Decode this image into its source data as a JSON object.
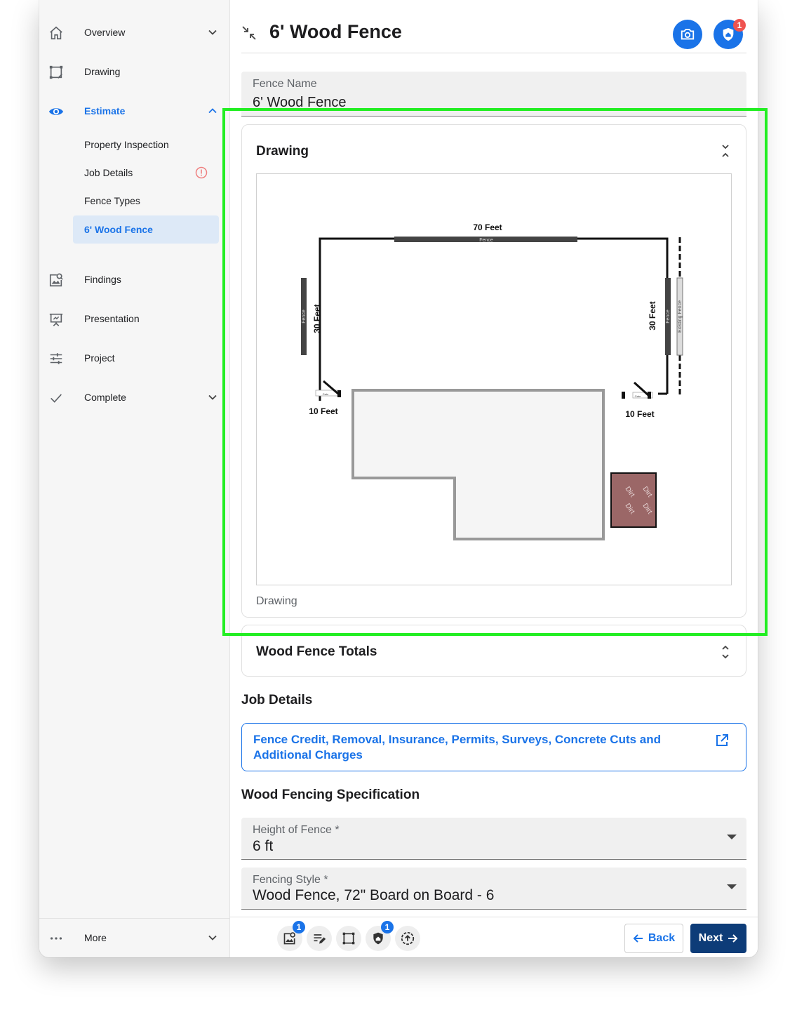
{
  "sidebar": {
    "items": [
      {
        "label": "Overview"
      },
      {
        "label": "Drawing"
      },
      {
        "label": "Estimate"
      },
      {
        "label": "Findings"
      },
      {
        "label": "Presentation"
      },
      {
        "label": "Project"
      },
      {
        "label": "Complete"
      }
    ],
    "estimate_children": [
      {
        "label": "Property Inspection"
      },
      {
        "label": "Job Details"
      },
      {
        "label": "Fence Types"
      },
      {
        "label": "6' Wood Fence"
      }
    ],
    "more_label": "More"
  },
  "header": {
    "title": "6' Wood Fence",
    "notification_count": "1"
  },
  "fence_name": {
    "label": "Fence Name",
    "value": "6' Wood Fence"
  },
  "drawing_card": {
    "title": "Drawing",
    "caption": "Drawing",
    "labels": {
      "top_length": "70 Feet",
      "top_segment": "Fence",
      "left_length": "30 Feet",
      "left_segment": "Fence",
      "right_length": "30 Feet",
      "right_segment": "Fence",
      "existing": "Existing Fence",
      "left_gate_length": "10 Feet",
      "right_gate_length": "10 Feet",
      "gate": "Gate",
      "dirt": "Dirt"
    }
  },
  "totals_card": {
    "title": "Wood Fence Totals"
  },
  "job_details": {
    "heading": "Job Details",
    "link_text": "Fence Credit, Removal, Insurance, Permits, Surveys, Concrete Cuts and Additional Charges"
  },
  "specification": {
    "heading": "Wood Fencing Specification",
    "height": {
      "label": "Height of Fence *",
      "value": "6 ft"
    },
    "style": {
      "label": "Fencing Style *",
      "value": "Wood Fence, 72\" Board on Board - 6"
    }
  },
  "bottom_bar": {
    "findings_badge": "1",
    "inspection_badge": "1",
    "back_label": "Back",
    "next_label": "Next"
  },
  "colors": {
    "accent": "#1a73e8",
    "primary_button": "#0d3c78",
    "alert": "#ef5350",
    "highlight": "#22ee22",
    "dirt": "#9b6767"
  }
}
